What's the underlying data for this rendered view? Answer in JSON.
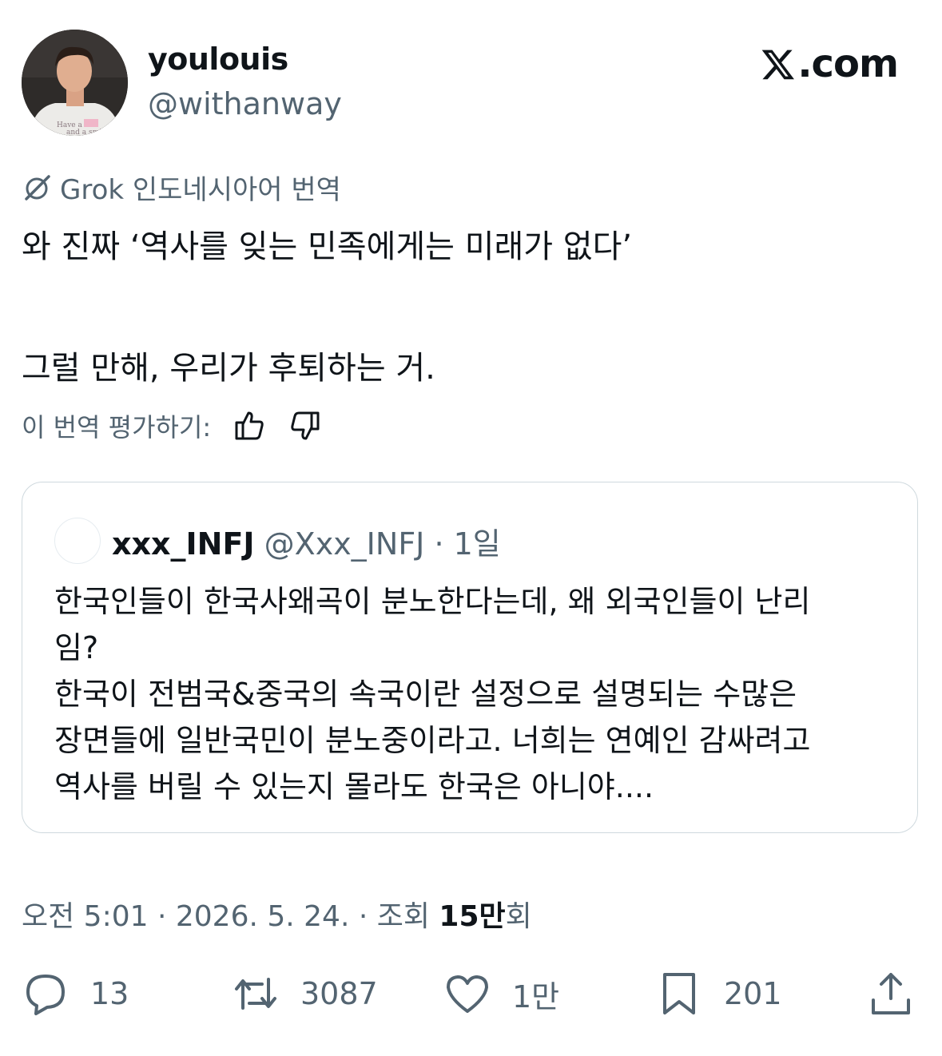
{
  "author": {
    "display_name": "youlouis",
    "handle": "@withanway",
    "avatar_icon": "profile-photo"
  },
  "brand": {
    "text": ".com",
    "logo_icon": "x-logo-icon"
  },
  "translation": {
    "label": "Grok 인도네시아어 번역",
    "icon": "grok-icon"
  },
  "tweet": {
    "line1": "와 진짜 ‘역사를 잊는 민족에게는 미래가 없다’",
    "line2": "그럴 만해, 우리가 후퇴하는 거."
  },
  "rate": {
    "label": "이 번역 평가하기:",
    "up_icon": "thumbs-up-icon",
    "down_icon": "thumbs-down-icon"
  },
  "quote": {
    "name": "xxx_INFJ",
    "handle_time": "@Xxx_INFJ · 1일",
    "lines": [
      "한국인들이 한국사왜곡이 분노한다는데, 왜 외국인들이 난리",
      "임?",
      "한국이 전범국&중국의 속국이란 설정으로 설명되는 수많은",
      "장면들에 일반국민이 분노중이라고. 너희는 연예인 감싸려고",
      "역사를 버릴 수 있는지 몰라도 한국은 아니야...."
    ]
  },
  "meta": {
    "time_date": "오전 5:01 · 2026. 5. 24. · 조회 ",
    "views": "15만",
    "views_suffix": "회"
  },
  "actions": {
    "reply": "13",
    "retweet": "3087",
    "like": "1만",
    "bookmark": "201"
  },
  "colors": {
    "text": "#0f1419",
    "secondary": "#536471",
    "border": "#cfd9de"
  }
}
